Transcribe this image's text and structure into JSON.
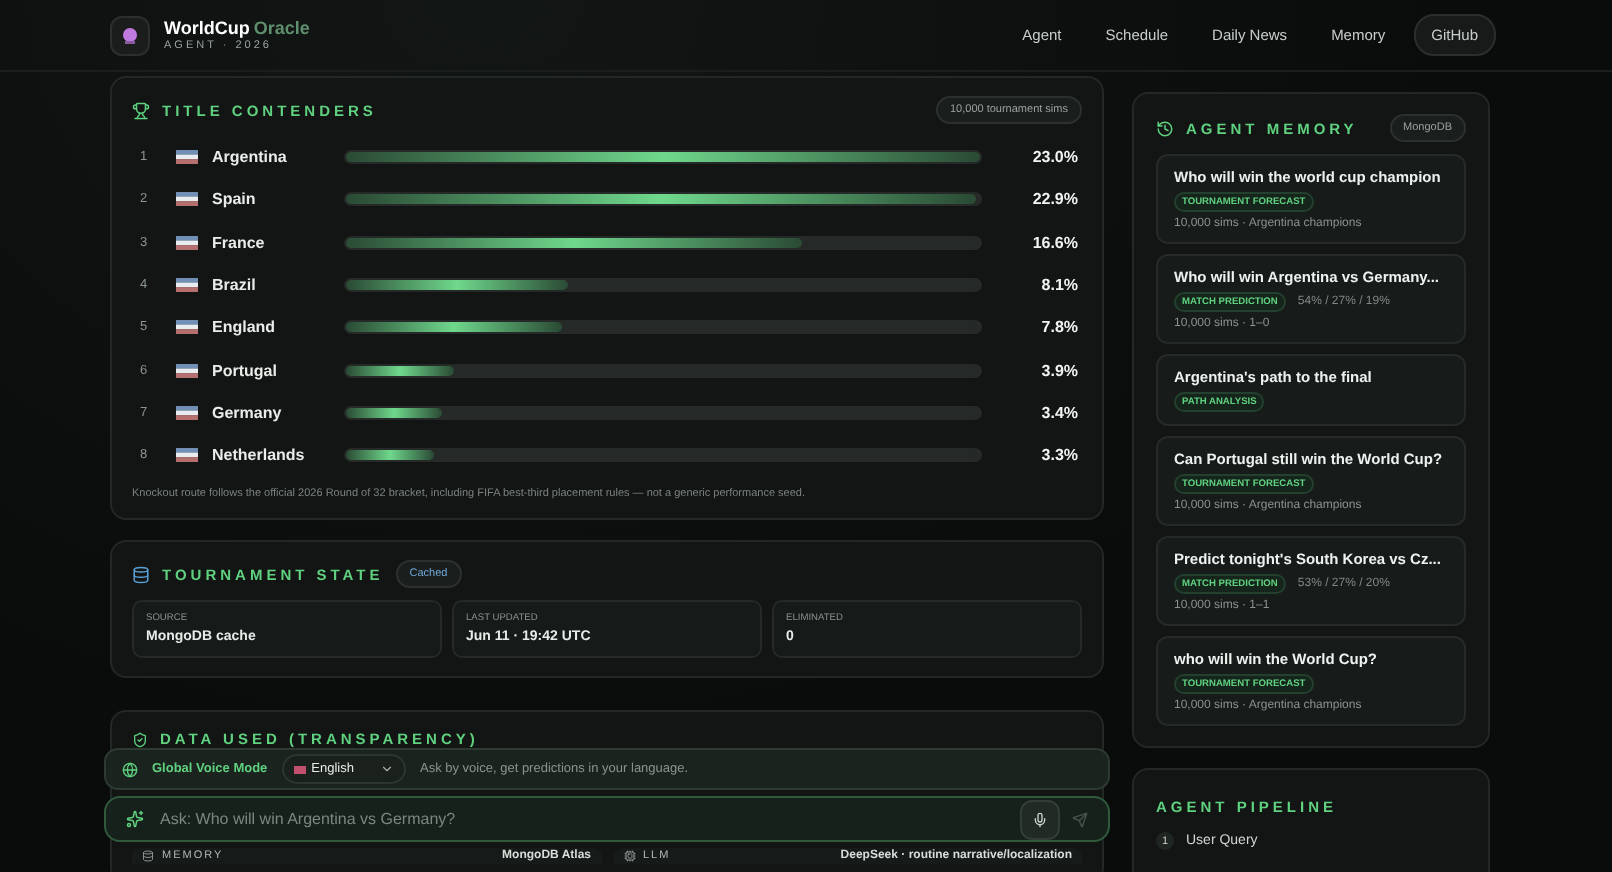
{
  "header": {
    "logo_text": "WorldCup",
    "logo_accent": "Oracle",
    "subtitle": "AGENT · 2026",
    "nav": [
      {
        "label": "Agent",
        "kind": "link"
      },
      {
        "label": "Schedule",
        "kind": "link"
      },
      {
        "label": "Daily News",
        "kind": "link"
      },
      {
        "label": "Memory",
        "kind": "link"
      },
      {
        "label": "GitHub",
        "kind": "pill"
      }
    ]
  },
  "contenders": {
    "title": "TITLE CONTENDERS",
    "badge": "10,000 tournament sims",
    "rows": [
      {
        "rank": "1",
        "team": "Argentina",
        "level": 1,
        "pct": "23.0%"
      },
      {
        "rank": "2",
        "team": "Spain",
        "level": 0.995,
        "pct": "22.9%"
      },
      {
        "rank": "3",
        "team": "France",
        "level": 0.72,
        "pct": "16.6%"
      },
      {
        "rank": "4",
        "team": "Brazil",
        "level": 0.35,
        "pct": "8.1%"
      },
      {
        "rank": "5",
        "team": "England",
        "level": 0.34,
        "pct": "7.8%"
      },
      {
        "rank": "6",
        "team": "Portugal",
        "level": 0.17,
        "pct": "3.9%"
      },
      {
        "rank": "7",
        "team": "Germany",
        "level": 0.15,
        "pct": "3.4%"
      },
      {
        "rank": "8",
        "team": "Netherlands",
        "level": 0.14,
        "pct": "3.3%"
      }
    ],
    "footnote": "Knockout route follows the official 2026 Round of 32 bracket, including FIFA best-third placement rules — not a generic performance seed."
  },
  "tournament_state": {
    "title": "TOURNAMENT STATE",
    "badge": "Cached",
    "stats": [
      {
        "label": "SOURCE",
        "value": "MongoDB cache"
      },
      {
        "label": "LAST UPDATED",
        "value": "Jun 11 · 19:42 UTC"
      },
      {
        "label": "ELIMINATED",
        "value": "0"
      }
    ]
  },
  "data_used": {
    "title": "DATA USED (TRANSPARENCY)",
    "rows": [
      {
        "label": "MEMORY",
        "value": "MongoDB Atlas"
      },
      {
        "label": "LLM",
        "value": "DeepSeek · routine narrative/localization"
      }
    ]
  },
  "voice_bar": {
    "label": "Global Voice Mode",
    "language": "English",
    "hint": "Ask by voice, get predictions in your language."
  },
  "ask": {
    "placeholder": "Ask: Who will win Argentina vs Germany?"
  },
  "memory": {
    "title": "AGENT MEMORY",
    "badge": "MongoDB",
    "items": [
      {
        "question": "Who will win the world cup champion",
        "tag": "TOURNAMENT FORECAST",
        "meta": "10,000 sims · Argentina champions"
      },
      {
        "question": "Who will win Argentina vs Germany...",
        "tag": "MATCH PREDICTION",
        "odds": "54% / 27% / 19%",
        "meta": "10,000 sims · 1–0"
      },
      {
        "question": "Argentina's path to the final",
        "tag": "PATH ANALYSIS"
      },
      {
        "question": "Can Portugal still win the World Cup?",
        "tag": "TOURNAMENT FORECAST",
        "meta": "10,000 sims · Argentina champions"
      },
      {
        "question": "Predict tonight's South Korea vs Cz...",
        "tag": "MATCH PREDICTION",
        "odds": "53% / 27% / 20%",
        "meta": "10,000 sims · 1–1"
      },
      {
        "question": "who will win the World Cup?",
        "tag": "TOURNAMENT FORECAST",
        "meta": "10,000 sims · Argentina champions"
      }
    ]
  },
  "pipeline": {
    "title": "AGENT PIPELINE",
    "steps": [
      {
        "number": "1",
        "label": "User Query"
      }
    ]
  }
}
